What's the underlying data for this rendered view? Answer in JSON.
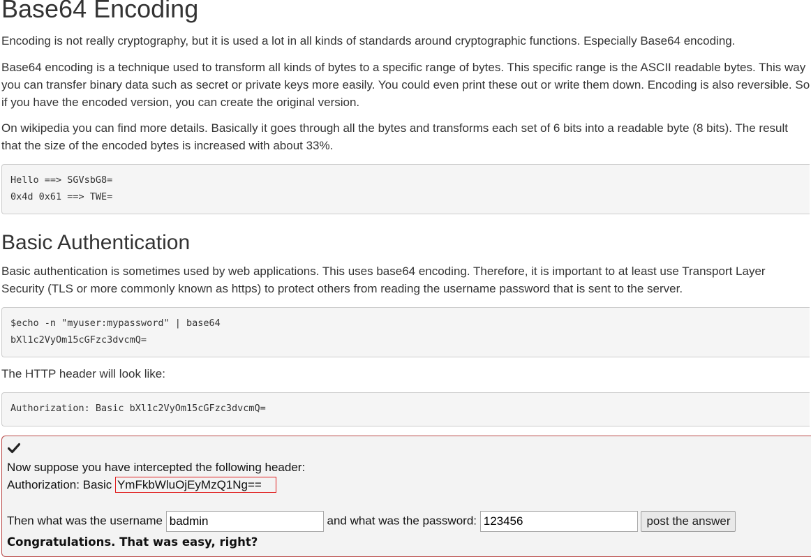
{
  "base64": {
    "title": "Base64 Encoding",
    "p1": "Encoding is not really cryptography, but it is used a lot in all kinds of standards around cryptographic functions. Especially Base64 encoding.",
    "p2": "Base64 encoding is a technique used to transform all kinds of bytes to a specific range of bytes. This specific range is the ASCII readable bytes. This way you can transfer binary data such as secret or private keys more easily. You could even print these out or write them down. Encoding is also reversible. So if you have the encoded version, you can create the original version.",
    "p3": "On wikipedia you can find more details. Basically it goes through all the bytes and transforms each set of 6 bits into a readable byte (8 bits). The result that the size of the encoded bytes is increased with about 33%.",
    "code_line1": "Hello ==> SGVsbG8=",
    "code_line2": "0x4d 0x61 ==> TWE="
  },
  "basic_auth": {
    "title": "Basic Authentication",
    "p1": "Basic authentication is sometimes used by web applications. This uses base64 encoding. Therefore, it is important to at least use Transport Layer Security (TLS or more commonly known as https) to protect others from reading the username password that is sent to the server.",
    "code_line1": "$echo -n \"myuser:mypassword\" | base64",
    "code_line2": "bXl1c2VyOm15cGFzc3dvcmQ=",
    "header_intro": "The HTTP header will look like:",
    "header_example": "Authorization: Basic bXl1c2VyOm15cGFzc3dvcmQ="
  },
  "assignment": {
    "status_icon": "check-icon",
    "intro": "Now suppose you have intercepted the following header:",
    "auth_prefix": "Authorization: Basic ",
    "auth_value": "YmFkbWluOjEyMzQ1Ng==",
    "username_label": "Then what was the username",
    "username_value": "badmin",
    "password_label": "and what was the password:",
    "password_value": "123456",
    "submit_label": "post the answer",
    "feedback": "Congratulations. That was easy, right?",
    "colors": {
      "border": "#b94a48",
      "highlight": "#e02020"
    }
  }
}
